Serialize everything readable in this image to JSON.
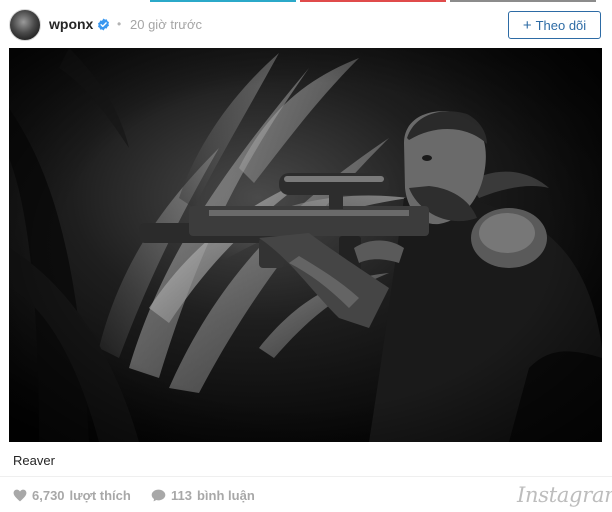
{
  "post": {
    "username": "wponx",
    "separator": "•",
    "time_ago": "20 giờ trước",
    "follow_label": "Theo dõi",
    "follow_plus": "+",
    "caption": "Reaver"
  },
  "stats": {
    "likes_count": "6,730",
    "likes_label": "lượt thích",
    "comments_count": "113",
    "comments_label": "bình luận"
  },
  "brand": {
    "name": "Instagram"
  },
  "icons": {
    "verified": "verified-badge-icon",
    "heart": "heart-icon",
    "comment": "comment-bubble-icon",
    "plus": "plus-icon"
  },
  "colors": {
    "accent": "#2d6ba5",
    "verified": "#3897f0",
    "muted": "#a8a8a8",
    "top_stripe_1": "#2ba9c9",
    "top_stripe_2": "#e04b4b",
    "top_stripe_3": "#8c8c8c"
  }
}
